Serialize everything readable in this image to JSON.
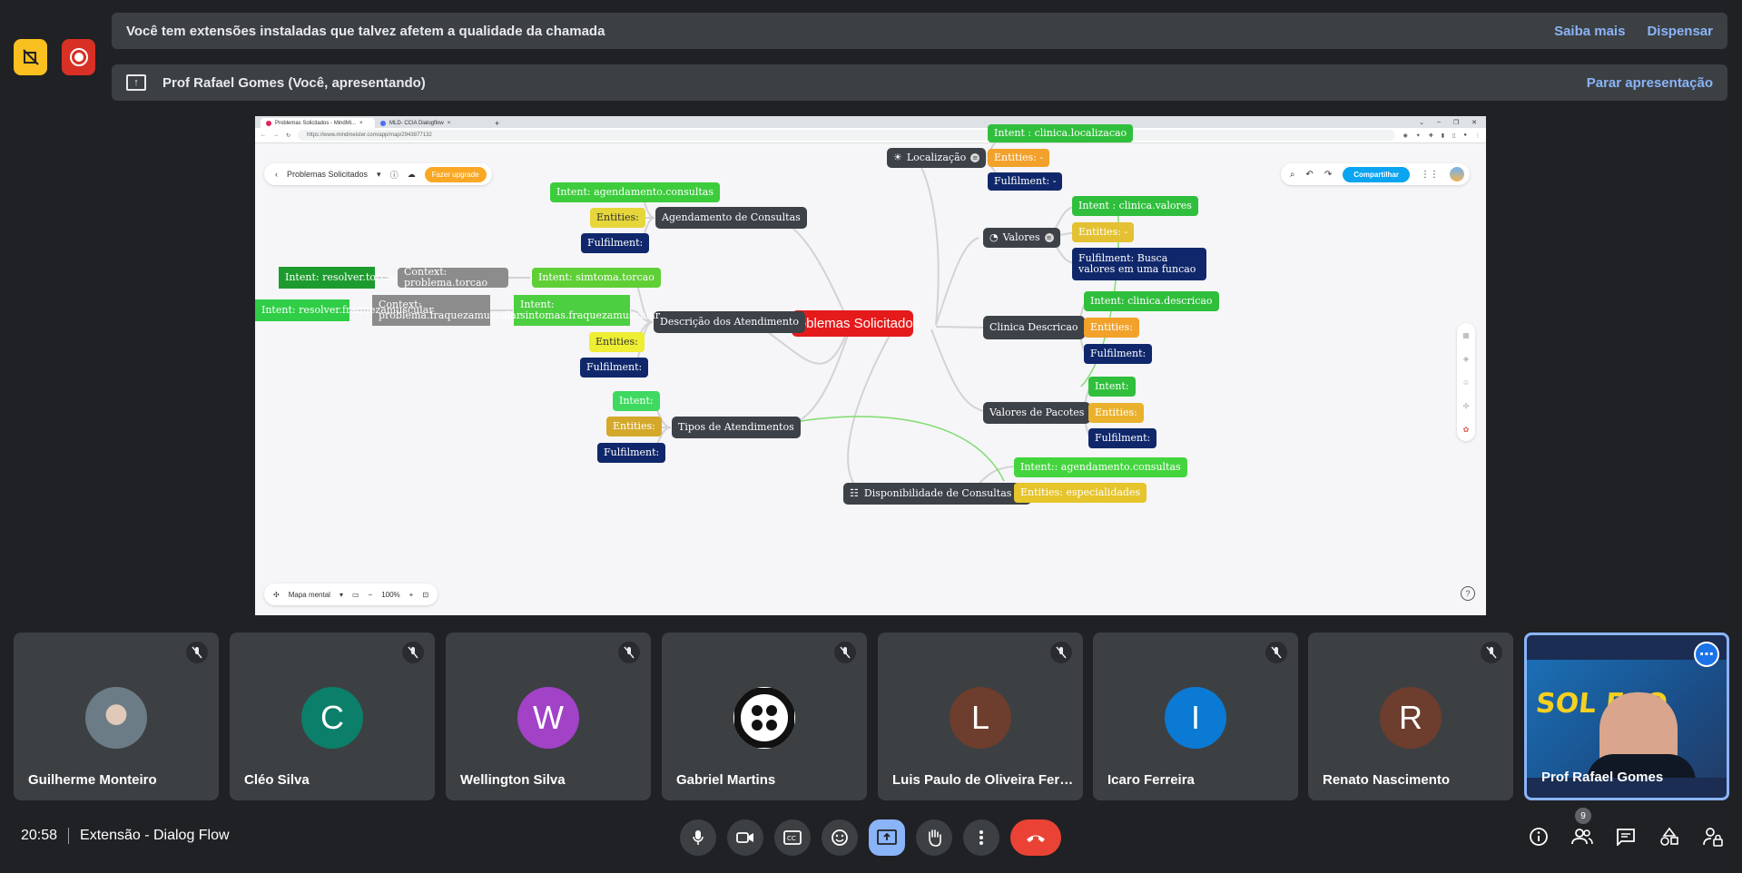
{
  "top_buttons": {
    "ext_icon": "no-extension-icon",
    "rec_icon": "record-icon"
  },
  "banner_extensions": {
    "text": "Você tem extensões instaladas que talvez afetem a qualidade da chamada",
    "learn_more": "Saiba mais",
    "dismiss": "Dispensar"
  },
  "banner_presenting": {
    "text": "Prof Rafael Gomes (Você, apresentando)",
    "stop": "Parar apresentação"
  },
  "browser": {
    "tabs": [
      "Problemas Solicitados - MindMi...",
      "MLD- CCIA Dialogflow"
    ],
    "url": "https://www.mindmeister.com/app/map/2943877132"
  },
  "mindmeister": {
    "map_title": "Problemas Solicitados",
    "upgrade": "Fazer upgrade",
    "share": "Compartilhar",
    "view_mode": "Mapa mental",
    "zoom": "100%",
    "help": "?"
  },
  "mindmap": {
    "center": "Problemas Solicitados",
    "localizacao": {
      "label": "Localização",
      "intent": "Intent : clinica.localizacao",
      "entities": "Entities: -",
      "fulfilment": "Fulfilment: -"
    },
    "valores": {
      "label": "Valores",
      "intent": "Intent : clinica.valores",
      "entities": "Entities: -",
      "fulfilment": "Fulfilment: Busca valores em uma funcao"
    },
    "clinica_descricao": {
      "label": "Clinica Descricao",
      "intent": "Intent: clinica.descricao",
      "entities": "Entities:",
      "fulfilment": "Fulfilment:"
    },
    "valores_pacotes": {
      "label": "Valores de Pacotes",
      "intent": "Intent:",
      "entities": "Entities:",
      "fulfilment": "Fulfilment:"
    },
    "disponibilidade": {
      "label": "Disponibilidade de Consultas",
      "intent": "Intent:: agendamento.consultas",
      "entities": "Entities: especialidades"
    },
    "agendamento": {
      "label": "Agendamento de Consultas",
      "intent": "Intent: agendamento.consultas",
      "entities": "Entities:",
      "fulfilment": "Fulfilment:"
    },
    "descricao_atendimento": {
      "label": "Descrição dos Atendimento",
      "intent_torcao": "Intent:  simtoma.torcao",
      "context_torcao": "Context: problema.torcao",
      "resolver_torcao": "Intent: resolver.torcao",
      "intent_fraqueza": "Intent: sintomas.fraquezamuscular",
      "context_fraqueza": "Context: problema.fraquezamuscular",
      "resolver_fraqueza": "Intent: resolver.fraquezamuscular",
      "entities": "Entities:",
      "fulfilment": "Fulfilment:"
    },
    "tipos": {
      "label": "Tipos de Atendimentos",
      "intent": "Intent:",
      "entities": "Entities:",
      "fulfilment": "Fulfilment:"
    }
  },
  "participants": [
    {
      "name": "Guilherme Monteiro",
      "initial": "",
      "color": "#6b7a80",
      "type": "photo"
    },
    {
      "name": "Cléo Silva",
      "initial": "C",
      "color": "#0b7f6a",
      "type": "letter"
    },
    {
      "name": "Wellington Silva",
      "initial": "W",
      "color": "#a142c7",
      "type": "letter"
    },
    {
      "name": "Gabriel Martins",
      "initial": "",
      "color": "#ffffff",
      "type": "logo"
    },
    {
      "name": "Luis Paulo de Oliveira Ferreira",
      "initial": "L",
      "color": "#6d3d2d",
      "type": "letter"
    },
    {
      "name": "Icaro Ferreira",
      "initial": "I",
      "color": "#0b7ad4",
      "type": "letter"
    },
    {
      "name": "Renato Nascimento",
      "initial": "R",
      "color": "#6d3d2d",
      "type": "letter"
    }
  ],
  "self_tile": {
    "name": "Prof Rafael Gomes",
    "brand_text": "SOL ECO"
  },
  "meeting": {
    "time": "20:58",
    "title": "Extensão - Dialog Flow",
    "people_count": "9"
  },
  "colors": {
    "accent": "#8ab4f8",
    "end_call": "#ea4335",
    "bg": "#202124"
  }
}
